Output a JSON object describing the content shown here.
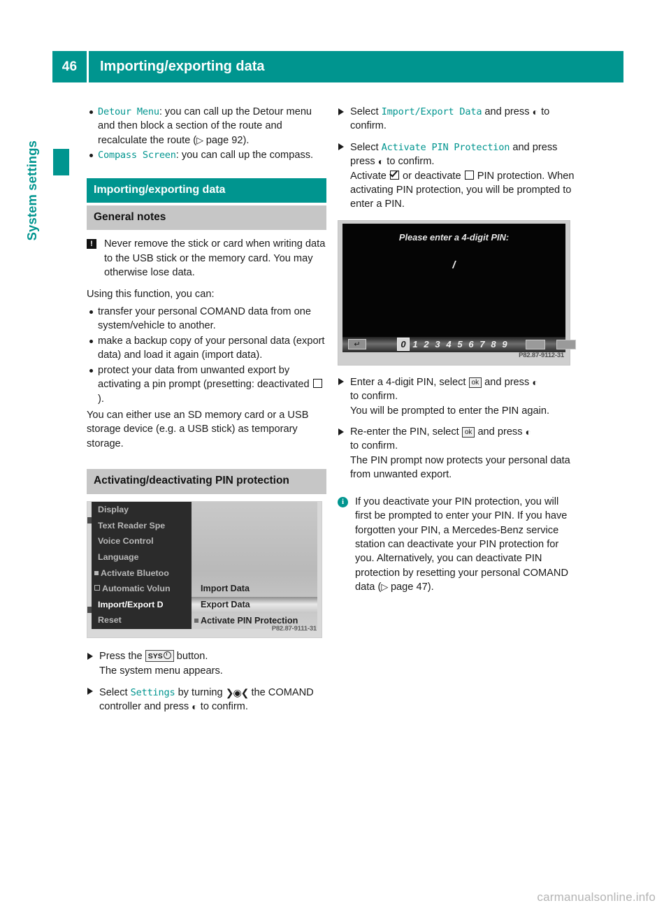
{
  "header": {
    "page_number": "46",
    "title": "Importing/exporting data"
  },
  "side_tab": {
    "label": "System settings"
  },
  "colors": {
    "accent_teal": "#00958f",
    "band_grey": "#c6c6c6"
  },
  "left_column": {
    "bullets": [
      {
        "term": "Detour Menu",
        "text": ": you can call up the Detour menu and then block a section of the route and recalculate the route (",
        "ref": "page 92",
        "tail": ")."
      },
      {
        "term": "Compass Screen",
        "text": ": you can call up the compass.",
        "ref": "",
        "tail": ""
      }
    ],
    "section_heading": "Importing/exporting data",
    "subsection_heading": "General notes",
    "warning_note": "Never remove the stick or card when writing data to the USB stick or the memory card. You may otherwise lose data.",
    "intro": "Using this function, you can:",
    "capability_bullets": [
      "transfer your personal COMAND data from one system/vehicle to another.",
      "make a backup copy of your personal data (export data) and load it again (import data).",
      "protect your data from unwanted export by activating a pin prompt (presetting: deactivated"
    ],
    "capability_bullet3_tail": ").",
    "storage_paragraph": "You can either use an SD memory card or a USB storage device (e.g. a USB stick) as temporary storage.",
    "pin_heading": "Activating/deactivating PIN protection",
    "menu_screenshot": {
      "left_items": [
        {
          "label": "Display",
          "checkbox": "none",
          "selected": false
        },
        {
          "label": "Text Reader Spe",
          "checkbox": "none",
          "selected": false
        },
        {
          "label": "Voice Control",
          "checkbox": "none",
          "selected": false
        },
        {
          "label": "Language",
          "checkbox": "none",
          "selected": false
        },
        {
          "label": "Activate Bluetoo",
          "checkbox": "filled",
          "selected": false
        },
        {
          "label": "Automatic Volun",
          "checkbox": "empty",
          "selected": false
        },
        {
          "label": "Import/Export D",
          "checkbox": "none",
          "selected": true
        },
        {
          "label": "Reset",
          "checkbox": "none",
          "selected": false
        }
      ],
      "right_items": [
        {
          "label": "Import Data",
          "checkbox": "none",
          "highlighted": false
        },
        {
          "label": "Export Data",
          "checkbox": "none",
          "highlighted": true
        },
        {
          "label": "Activate PIN Protection",
          "checkbox": "filled",
          "highlighted": false
        }
      ],
      "caption": "P82.87-9111-31"
    },
    "steps": [
      {
        "pre": "Press the",
        "button": "SYS",
        "post": "button.",
        "result": "The system menu appears."
      },
      {
        "pre": "Select",
        "mono": "Settings",
        "mid": "by turning",
        "post": "the COMAND controller and press",
        "tail": "to confirm."
      }
    ]
  },
  "right_column": {
    "steps": [
      {
        "pre": "Select",
        "mono": "Import/Export Data",
        "mid": "and press",
        "tail": "to confirm."
      },
      {
        "pre": "Select",
        "mono": "Activate PIN Protection",
        "mid": "and press",
        "tail": "to confirm.",
        "extra_pre": "Activate",
        "extra_mid": "or deactivate",
        "extra_post": "PIN protection. When activating PIN protection, you will be prompted to enter a PIN."
      }
    ],
    "pin_screenshot": {
      "prompt": "Please enter a 4-digit PIN:",
      "cursor": "/",
      "digits": [
        "0",
        "1",
        "2",
        "3",
        "4",
        "5",
        "6",
        "7",
        "8",
        "9"
      ],
      "selected_digit": "0",
      "caption": "P82.87-9112-31"
    },
    "steps2": [
      {
        "pre": "Enter a 4-digit PIN, select",
        "ok": "ok",
        "mid": "and press",
        "tail": "to confirm.",
        "result": "You will be prompted to enter the PIN again."
      },
      {
        "pre": "Re-enter the PIN, select",
        "ok": "ok",
        "mid": "and press",
        "tail": "to confirm.",
        "result": "The PIN prompt now protects your personal data from unwanted export."
      }
    ],
    "info_note": "If you deactivate your PIN protection, you will first be prompted to enter your PIN. If you have forgotten your PIN, a Mercedes-Benz service station can deactivate your PIN protection for you. Alternatively, you can deactivate PIN protection by resetting your personal COMAND data (",
    "info_note_ref": "page 47",
    "info_note_tail": ")."
  },
  "watermark": "carmanualsonline.info"
}
